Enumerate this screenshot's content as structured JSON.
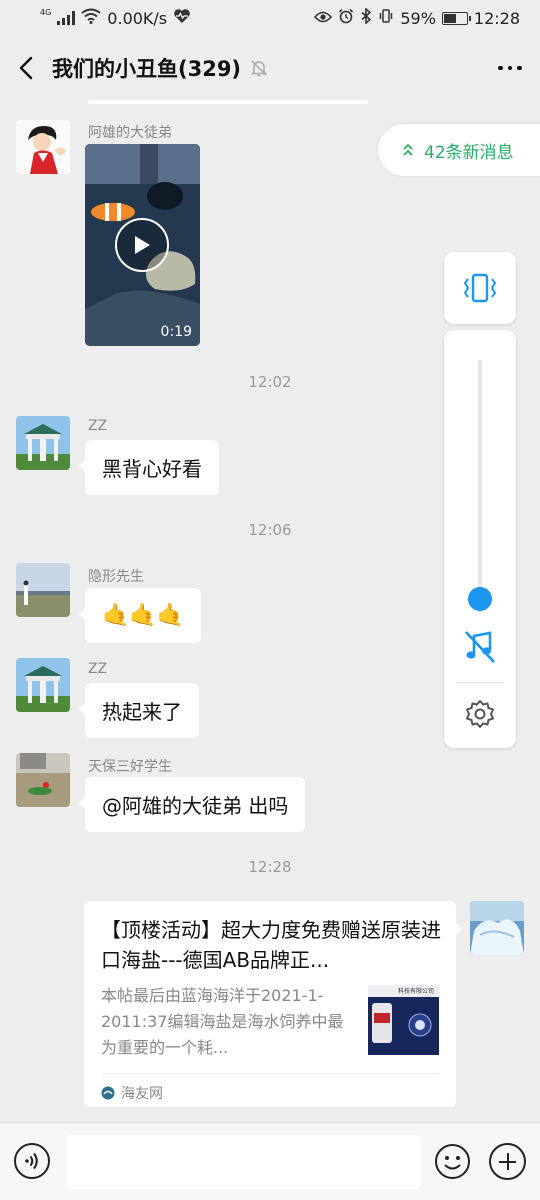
{
  "status_bar": {
    "network_tag": "4G",
    "speed": "0.00K/s",
    "battery": "59%",
    "battery_level": 0.59,
    "time": "12:28",
    "icons": [
      "signal-icon",
      "wifi-icon",
      "heart-rate-icon",
      "eye-icon",
      "alarm-icon",
      "bluetooth-icon",
      "vibrate-icon",
      "battery-icon"
    ]
  },
  "header": {
    "title": "我们的小丑鱼(329)",
    "icons": [
      "back-icon",
      "mute-bell-icon",
      "more-icon"
    ]
  },
  "new_messages": {
    "label": "42条新消息"
  },
  "messages": [
    {
      "sender": "阿雄的大徒弟",
      "type": "video",
      "duration": "0:19"
    },
    {
      "time": "12:02"
    },
    {
      "sender": "ZZ",
      "text": "黑背心好看"
    },
    {
      "time": "12:06"
    },
    {
      "sender": "隐形先生",
      "text": "🤙🤙🤙"
    },
    {
      "sender": "ZZ",
      "text": "热起来了"
    },
    {
      "sender": "天保三好学生",
      "text": "@阿雄的大徒弟  出吗"
    },
    {
      "time": "12:28"
    },
    {
      "type": "link",
      "title": "【顶楼活动】超大力度免费赠送原装进口海盐---德国AB品牌正...",
      "description": "本帖最后由蓝海海洋于2021-1-2011:37编辑海盐是海水饲养中最为重要的一个耗...",
      "source": "海友网",
      "thumb_text": "科技有限公司"
    }
  ],
  "volume_panel": {
    "level": 0.05,
    "icons": [
      "vibrate-icon",
      "music-off-icon",
      "settings-icon"
    ]
  },
  "input_bar": {
    "placeholder": "",
    "icons": [
      "voice-icon",
      "emoji-icon",
      "plus-icon"
    ]
  },
  "colors": {
    "accent_green": "#2aae67",
    "volume_blue": "#1a96f0",
    "background": "#ededed"
  }
}
